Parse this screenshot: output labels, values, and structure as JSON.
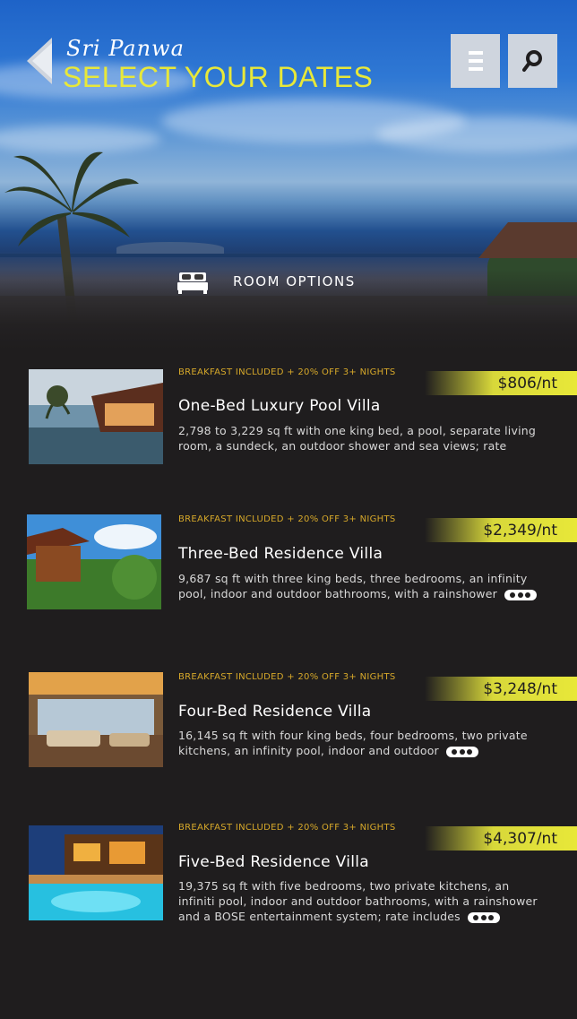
{
  "header": {
    "subtitle": "Sri Panwa",
    "title": "SELECT YOUR DATES",
    "back_icon": "chevron-left-icon",
    "menu_icon": "hamburger-icon",
    "search_icon": "search-icon",
    "accent_color": "#e8e839"
  },
  "room_options": {
    "icon": "bed-icon",
    "label": "ROOM OPTIONS"
  },
  "rooms": [
    {
      "promo": "BREAKFAST INCLUDED + 20% OFF 3+ NIGHTS",
      "price": "$806/nt",
      "name": "One-Bed Luxury Pool Villa",
      "description": "2,798 to 3,229 sq ft with one king bed, a pool, separate living room, a sundeck, an outdoor shower and sea views; rate"
    },
    {
      "promo": "BREAKFAST INCLUDED + 20% OFF 3+ NIGHTS",
      "price": "$2,349/nt",
      "name": "Three-Bed Residence Villa",
      "description": "9,687 sq ft with three king beds, three bedrooms, an infinity pool, indoor and outdoor bathrooms, with a rainshower"
    },
    {
      "promo": "BREAKFAST INCLUDED + 20% OFF 3+ NIGHTS",
      "price": "$3,248/nt",
      "name": "Four-Bed Residence Villa",
      "description": "16,145 sq ft with four king beds, four bedrooms, two private kitchens, an infinity pool, indoor and outdoor"
    },
    {
      "promo": "BREAKFAST INCLUDED + 20% OFF 3+ NIGHTS",
      "price": "$4,307/nt",
      "name": "Five-Bed Residence Villa",
      "description": "19,375 sq ft with five bedrooms, two private kitchens, an infiniti pool, indoor and outdoor bathrooms, with a rainshower and a BOSE entertainment system; rate includes"
    }
  ]
}
